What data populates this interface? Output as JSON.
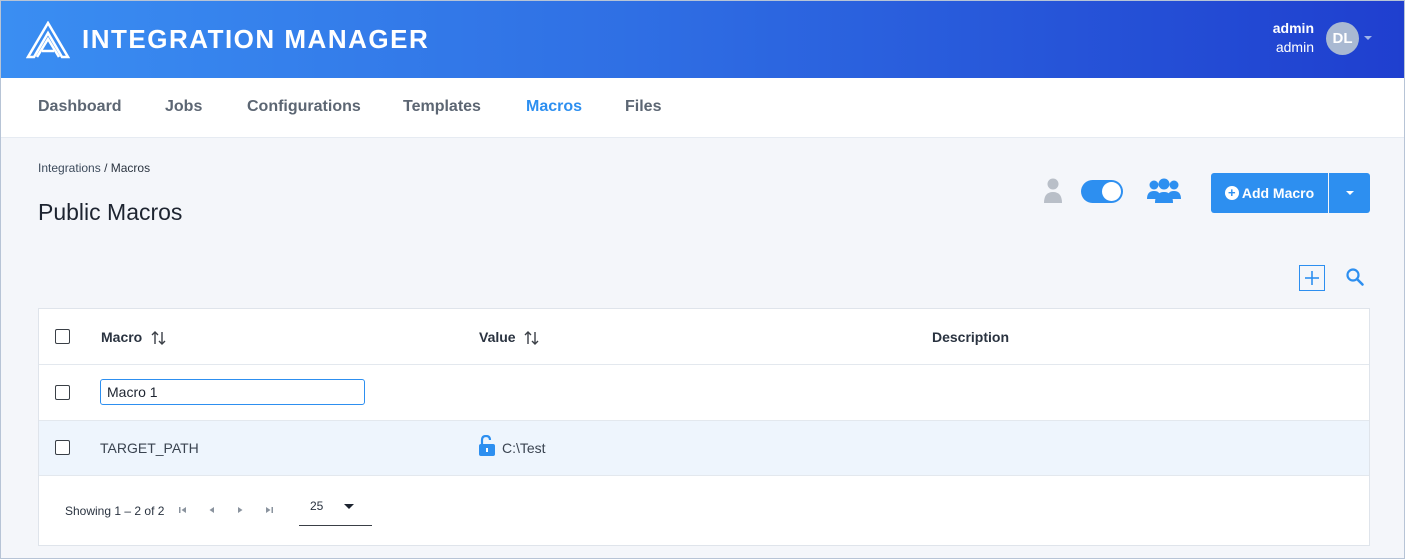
{
  "app": {
    "title": "INTEGRATION MANAGER",
    "user": {
      "name": "admin",
      "role": "admin",
      "initials": "DL"
    }
  },
  "nav": {
    "items": [
      {
        "label": "Dashboard",
        "active": false
      },
      {
        "label": "Jobs",
        "active": false
      },
      {
        "label": "Configurations",
        "active": false
      },
      {
        "label": "Templates",
        "active": false
      },
      {
        "label": "Macros",
        "active": true
      },
      {
        "label": "Files",
        "active": false
      }
    ]
  },
  "breadcrumb": {
    "parent": "Integrations",
    "separator": "/",
    "current": "Macros"
  },
  "page": {
    "title": "Public Macros"
  },
  "toolbar": {
    "add_label": "Add Macro",
    "visibility_toggle": {
      "on": true,
      "left_icon": "person-icon",
      "right_icon": "group-icon"
    }
  },
  "table": {
    "headers": {
      "macro": "Macro",
      "value": "Value",
      "description": "Description"
    },
    "edit_row": {
      "macro_input_value": "Macro 1"
    },
    "rows": [
      {
        "macro": "TARGET_PATH",
        "value": "C:\\Test",
        "description": "",
        "value_icon": "lock-open-icon"
      }
    ],
    "footer": {
      "showing": "Showing 1 – 2 of 2",
      "page_size": "25"
    }
  },
  "colors": {
    "accent": "#2d8ff0",
    "header_gradient_start": "#3a8ef2",
    "header_gradient_end": "#1f3fcf"
  }
}
